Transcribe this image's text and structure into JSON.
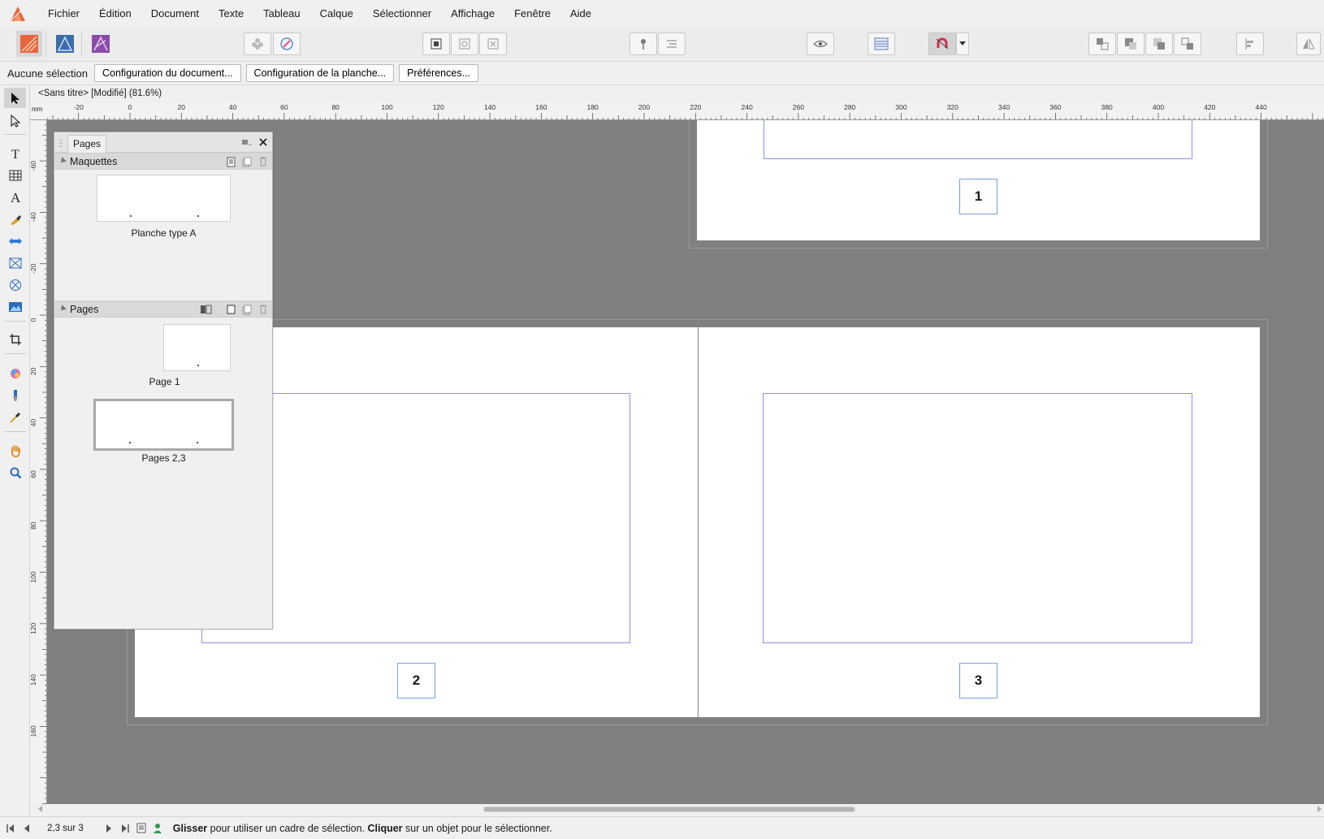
{
  "menubar": {
    "items": [
      "Fichier",
      "Édition",
      "Document",
      "Texte",
      "Tableau",
      "Calque",
      "Sélectionner",
      "Affichage",
      "Fenêtre",
      "Aide"
    ]
  },
  "contextbar": {
    "selection_label": "Aucune sélection",
    "doc_setup": "Configuration du document...",
    "spread_setup": "Configuration de la planche...",
    "preferences": "Préférences..."
  },
  "document_tab": {
    "title": "<Sans titre> [Modifié] (81.6%)"
  },
  "ruler": {
    "unit": "mm",
    "h_labels": [
      "-20",
      "0",
      "20",
      "40",
      "60",
      "80",
      "100",
      "120",
      "140",
      "160",
      "180",
      "200",
      "220",
      "240",
      "260",
      "280",
      "300",
      "320",
      "340",
      "360",
      "380",
      "400",
      "420",
      "440"
    ],
    "v_labels": [
      "-60",
      "-40",
      "-20",
      "0",
      "20",
      "40",
      "60",
      "80",
      "100",
      "120",
      "140",
      "160"
    ]
  },
  "canvas": {
    "page_numbers": [
      "1",
      "2",
      "3"
    ]
  },
  "pages_panel": {
    "tab": "Pages",
    "masters_title": "Maquettes",
    "master_label": "Planche type A",
    "pages_title": "Pages",
    "page1_label": "Page 1",
    "spread_label": "Pages 2,3"
  },
  "statusbar": {
    "page_count": "2,3 sur 3",
    "hint_drag": "Glisser",
    "hint_drag_text": " pour utiliser un cadre de sélection. ",
    "hint_click": "Cliquer",
    "hint_click_text": " sur un objet pour le sélectionner."
  },
  "colors": {
    "canvas_bg": "#808080",
    "frame_border": "#8c8ff0",
    "pagenum_border": "#7aa0d8",
    "publisher_brand": "#e8643c"
  }
}
